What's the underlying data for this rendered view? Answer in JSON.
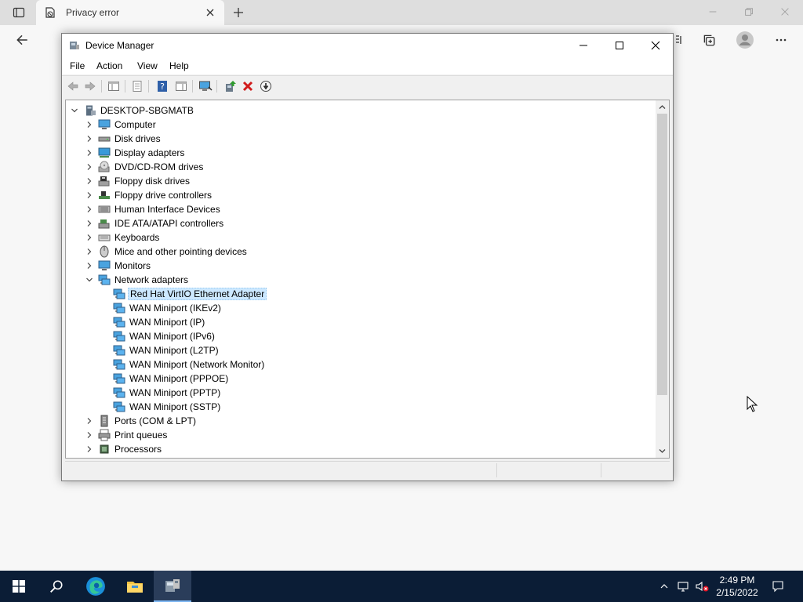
{
  "browser": {
    "tab_title": "Privacy error",
    "icons": [
      "tab-actions-icon",
      "privacy-error-icon",
      "close-icon",
      "plus-icon",
      "back-arrow-icon",
      "favorites-icon",
      "collections-icon",
      "profile-icon",
      "more-icon"
    ]
  },
  "device_manager": {
    "title": "Device Manager",
    "menu": [
      "File",
      "Action",
      "View",
      "Help"
    ],
    "toolbar_icons": [
      "back-icon",
      "forward-icon",
      "show-hide-console-tree-icon",
      "properties-icon",
      "help-icon",
      "action-pane-icon",
      "scan-hardware-icon",
      "update-driver-icon",
      "uninstall-icon",
      "disable-device-icon"
    ],
    "tree": {
      "root": "DESKTOP-SBGMATB",
      "categories": [
        {
          "label": "Computer",
          "icon": "computer-icon",
          "expanded": false
        },
        {
          "label": "Disk drives",
          "icon": "disk-drive-icon",
          "expanded": false
        },
        {
          "label": "Display adapters",
          "icon": "display-adapter-icon",
          "expanded": false
        },
        {
          "label": "DVD/CD-ROM drives",
          "icon": "dvd-drive-icon",
          "expanded": false
        },
        {
          "label": "Floppy disk drives",
          "icon": "floppy-disk-icon",
          "expanded": false
        },
        {
          "label": "Floppy drive controllers",
          "icon": "floppy-controller-icon",
          "expanded": false
        },
        {
          "label": "Human Interface Devices",
          "icon": "hid-icon",
          "expanded": false
        },
        {
          "label": "IDE ATA/ATAPI controllers",
          "icon": "ide-controller-icon",
          "expanded": false
        },
        {
          "label": "Keyboards",
          "icon": "keyboard-icon",
          "expanded": false
        },
        {
          "label": "Mice and other pointing devices",
          "icon": "mouse-icon",
          "expanded": false
        },
        {
          "label": "Monitors",
          "icon": "monitor-icon",
          "expanded": false
        },
        {
          "label": "Network adapters",
          "icon": "network-adapter-icon",
          "expanded": true,
          "children": [
            {
              "label": "Red Hat VirtIO Ethernet Adapter",
              "selected": true
            },
            {
              "label": "WAN Miniport (IKEv2)"
            },
            {
              "label": "WAN Miniport (IP)"
            },
            {
              "label": "WAN Miniport (IPv6)"
            },
            {
              "label": "WAN Miniport (L2TP)"
            },
            {
              "label": "WAN Miniport (Network Monitor)"
            },
            {
              "label": "WAN Miniport (PPPOE)"
            },
            {
              "label": "WAN Miniport (PPTP)"
            },
            {
              "label": "WAN Miniport (SSTP)"
            }
          ]
        },
        {
          "label": "Ports (COM & LPT)",
          "icon": "port-icon",
          "expanded": false
        },
        {
          "label": "Print queues",
          "icon": "printer-icon",
          "expanded": false
        },
        {
          "label": "Processors",
          "icon": "processor-icon",
          "expanded": false
        }
      ]
    }
  },
  "taskbar": {
    "apps": [
      "windows-start-icon",
      "search-icon",
      "edge-icon",
      "file-explorer-icon",
      "device-manager-icon"
    ],
    "tray_icons": [
      "chevron-up-icon",
      "network-icon",
      "volume-muted-icon"
    ],
    "time": "2:49 PM",
    "date": "2/15/2022",
    "notification_icon": "notification-icon"
  },
  "colors": {
    "selection": "#cce8ff",
    "taskbar": "#0b1d36",
    "window_bg": "#f0f0f0"
  }
}
